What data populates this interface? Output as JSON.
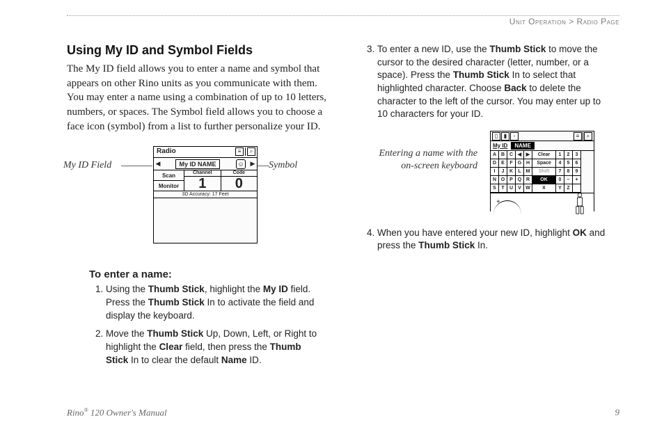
{
  "breadcrumb": {
    "section": "Unit Operation",
    "sep": ">",
    "page": "Radio Page"
  },
  "left": {
    "title": "Using My ID and Symbol Fields",
    "intro": "The My ID field allows you to enter a name and symbol that appears on other Rino units as you communicate with them. You may enter a name using a combination of up to 10 letters, numbers, or spaces. The Symbol field allows you to choose a face icon (symbol) from a list to further personalize your ID.",
    "fig": {
      "label_left": "My ID Field",
      "label_right": "Symbol",
      "screen": {
        "title": "Radio",
        "tb_a": "≡",
        "tb_b": "⌕",
        "myid_label": "My ID",
        "myid_value": "NAME",
        "face": "☺",
        "scan": "Scan",
        "monitor": "Monitor",
        "hdr_channel": "Channel",
        "hdr_code": "Code",
        "val_channel": "1",
        "val_code": "0",
        "accuracy": "3D Accuracy: 17 Feet"
      }
    },
    "subhead": "To enter a name:",
    "step1": {
      "a": "Using the ",
      "b1": "Thumb Stick",
      "c": ", highlight the ",
      "b2": "My ID",
      "d": " field. Press the ",
      "b3": "Thumb Stick",
      "e": " In to activate the field and display the keyboard."
    },
    "step2": {
      "a": "Move the ",
      "b1": "Thumb Stick",
      "c": " Up, Down, Left, or Right to highlight the ",
      "b2": "Clear",
      "d": " field, then press the ",
      "b3": "Thumb Stick",
      "e": " In to clear the default ",
      "b4": "Name",
      "f": " ID."
    }
  },
  "right": {
    "step3": {
      "a": "To enter a new ID, use the ",
      "b1": "Thumb Stick",
      "c": " to move the cursor to the desired character (letter, number, or a space). Press the ",
      "b2": "Thumb Stick",
      "d": " In to select that highlighted character. Choose ",
      "b3": "Back",
      "e": " to delete the character to the left of the cursor. You may enter up to 10 characters for your ID."
    },
    "fig": {
      "callout": "Entering a name with the on-screen keyboard",
      "name_label": "My ID",
      "name_value": "NAME",
      "rows": [
        [
          "A",
          "B",
          "C",
          "◀",
          "▶",
          "Clear",
          "1",
          "2",
          "3"
        ],
        [
          "D",
          "E",
          "F",
          "G",
          "H",
          "Space",
          "4",
          "5",
          "6"
        ],
        [
          "I",
          "J",
          "K",
          "L",
          "M",
          "Shift",
          "7",
          "8",
          "9"
        ],
        [
          "N",
          "O",
          "P",
          "Q",
          "R",
          "OK",
          "0",
          "–",
          "+"
        ],
        [
          "S",
          "T",
          "U",
          "V",
          "W",
          "X",
          "Y",
          "Z",
          " "
        ]
      ]
    },
    "step4": {
      "a": "When you have entered your new ID, highlight ",
      "b1": "OK",
      "c": " and press the ",
      "b2": "Thumb Stick",
      "d": " In."
    }
  },
  "footer": {
    "left_a": "Rino",
    "left_b": " 120 Owner's Manual",
    "reg": "®",
    "pageno": "9"
  }
}
